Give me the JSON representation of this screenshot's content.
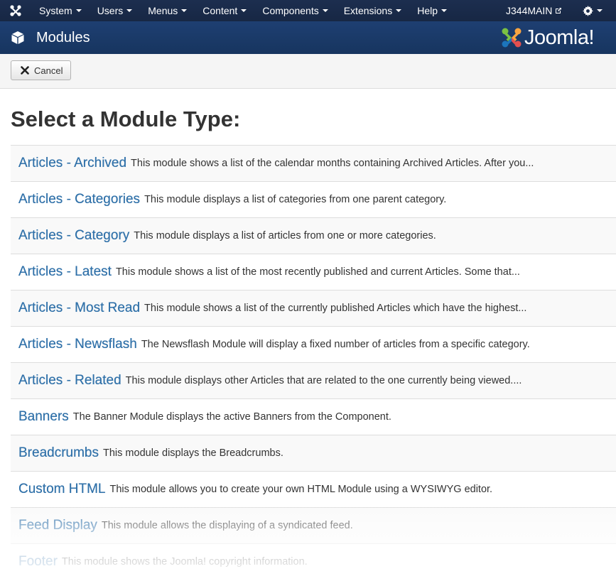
{
  "topnav": {
    "menu": [
      {
        "label": "System"
      },
      {
        "label": "Users"
      },
      {
        "label": "Menus"
      },
      {
        "label": "Content"
      },
      {
        "label": "Components"
      },
      {
        "label": "Extensions"
      },
      {
        "label": "Help"
      }
    ],
    "site_name": "J344MAIN"
  },
  "header": {
    "title": "Modules",
    "brand": "Joomla!"
  },
  "toolbar": {
    "cancel_label": "Cancel"
  },
  "main": {
    "heading": "Select a Module Type:",
    "modules": [
      {
        "name": "Articles - Archived",
        "description": "This module shows a list of the calendar months containing Archived Articles. After you..."
      },
      {
        "name": "Articles - Categories",
        "description": "This module displays a list of categories from one parent category."
      },
      {
        "name": "Articles - Category",
        "description": "This module displays a list of articles from one or more categories."
      },
      {
        "name": "Articles - Latest",
        "description": "This module shows a list of the most recently published and current Articles. Some that..."
      },
      {
        "name": "Articles - Most Read",
        "description": "This module shows a list of the currently published Articles which have the highest..."
      },
      {
        "name": "Articles - Newsflash",
        "description": "The Newsflash Module will display a fixed number of articles from a specific category."
      },
      {
        "name": "Articles - Related",
        "description": "This module displays other Articles that are related to the one currently being viewed...."
      },
      {
        "name": "Banners",
        "description": "The Banner Module displays the active Banners from the Component."
      },
      {
        "name": "Breadcrumbs",
        "description": "This module displays the Breadcrumbs."
      },
      {
        "name": "Custom HTML",
        "description": "This module allows you to create your own HTML Module using a WYSIWYG editor."
      },
      {
        "name": "Feed Display",
        "description": "This module allows the displaying of a syndicated feed."
      },
      {
        "name": "Footer",
        "description": "This module shows the Joomla! copyright information."
      }
    ]
  }
}
